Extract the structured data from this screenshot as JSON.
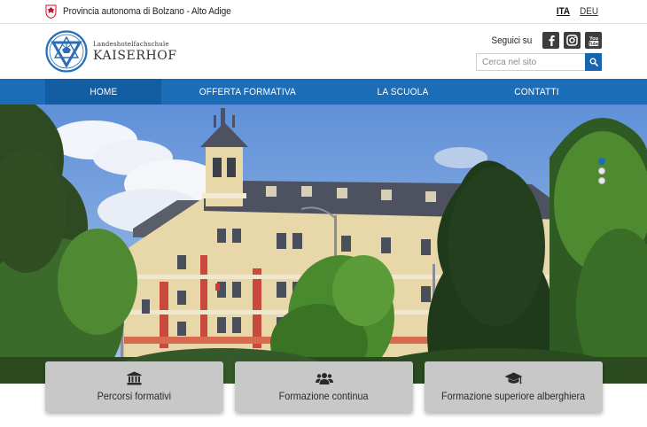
{
  "province": {
    "text": "Provincia autonoma di Bolzano - Alto Adige",
    "crest_icon": "eagle-crest-icon",
    "crest_color": "#c8102e"
  },
  "languages": [
    {
      "code": "ITA",
      "active": true
    },
    {
      "code": "DEU",
      "active": false
    }
  ],
  "logo": {
    "small_text": "Landeshotelfachschule",
    "big_text": "KAISERHOF",
    "emblem_color": "#2a6eb4"
  },
  "social": {
    "label": "Seguici su",
    "links": [
      {
        "name": "facebook",
        "icon": "facebook-icon"
      },
      {
        "name": "instagram",
        "icon": "instagram-icon"
      },
      {
        "name": "youtube",
        "icon": "youtube-icon"
      }
    ]
  },
  "search": {
    "placeholder": "Cerca nel sito",
    "value": "",
    "icon": "search-icon"
  },
  "nav": {
    "items": [
      {
        "label": "HOME",
        "active": true
      },
      {
        "label": "OFFERTA FORMATIVA",
        "active": false
      },
      {
        "label": "LA SCUOLA",
        "active": false
      },
      {
        "label": "CONTATTI",
        "active": false
      }
    ],
    "color": "#1b6db8"
  },
  "hero": {
    "slides_count": 3,
    "active_slide": 1
  },
  "cards": [
    {
      "label": "Percorsi formativi",
      "icon": "institution-icon"
    },
    {
      "label": "Formazione continua",
      "icon": "users-icon"
    },
    {
      "label": "Formazione superiore alberghiera",
      "icon": "graduation-cap-icon"
    }
  ]
}
